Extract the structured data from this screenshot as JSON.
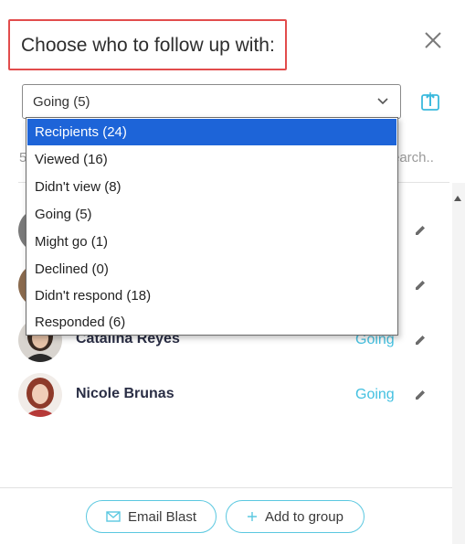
{
  "dialog": {
    "title": "Choose who to follow up with:"
  },
  "filter": {
    "selected": "Going (5)",
    "options": [
      "Recipients (24)",
      "Viewed (16)",
      "Didn't view (8)",
      "Going (5)",
      "Might go (1)",
      "Declined (0)",
      "Didn't respond (18)",
      "Responded (6)"
    ]
  },
  "list_header": {
    "count_partial": "5",
    "search_placeholder_partial": "earch.."
  },
  "people": [
    {
      "name": "Catalina Reyes",
      "status": "Going"
    },
    {
      "name": "Nicole Brunas",
      "status": "Going"
    }
  ],
  "footer": {
    "email_blast": "Email Blast",
    "add_to_group": "Add to group"
  },
  "colors": {
    "accent": "#43c0e0",
    "highlight": "#1d64d8",
    "title_border": "#e24c4c"
  }
}
